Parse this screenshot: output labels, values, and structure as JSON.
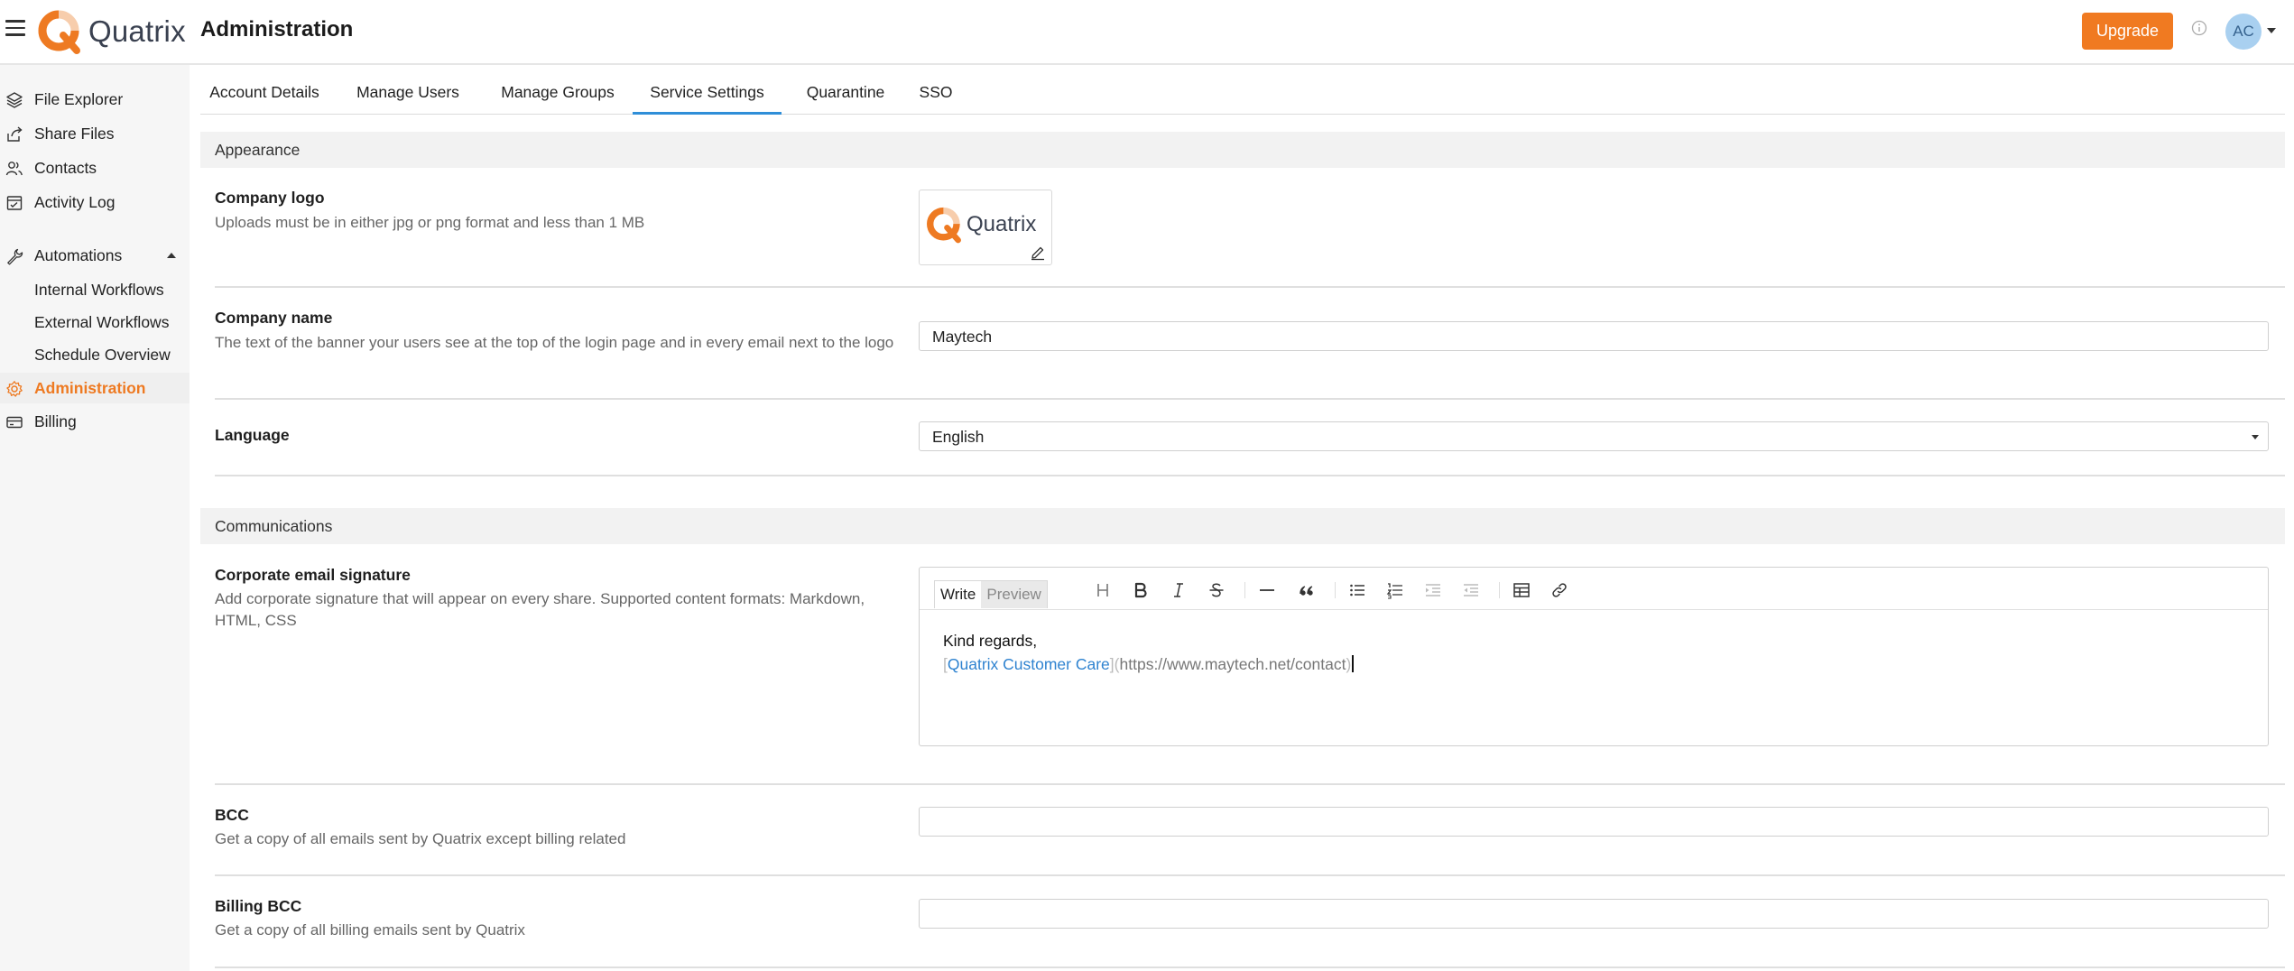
{
  "app": {
    "brand": "Quatrix",
    "page_title": "Administration",
    "upgrade_label": "Upgrade",
    "avatar_initials": "AC",
    "accent_color": "#f07a21"
  },
  "sidebar": {
    "items": [
      {
        "label": "File Explorer",
        "icon": "layers-icon"
      },
      {
        "label": "Share Files",
        "icon": "share-icon"
      },
      {
        "label": "Contacts",
        "icon": "users-icon"
      },
      {
        "label": "Activity Log",
        "icon": "log-icon"
      },
      {
        "label": "Automations",
        "icon": "wrench-icon",
        "expanded": true
      },
      {
        "label": "Internal Workflows"
      },
      {
        "label": "External Workflows"
      },
      {
        "label": "Schedule Overview"
      },
      {
        "label": "Administration",
        "icon": "gear-icon",
        "active": true
      },
      {
        "label": "Billing",
        "icon": "card-icon"
      }
    ]
  },
  "tabs": [
    {
      "label": "Account Details"
    },
    {
      "label": "Manage Users"
    },
    {
      "label": "Manage Groups"
    },
    {
      "label": "Service Settings",
      "active": true
    },
    {
      "label": "Quarantine"
    },
    {
      "label": "SSO"
    }
  ],
  "appearance": {
    "section_title": "Appearance",
    "logo": {
      "label": "Company logo",
      "desc": "Uploads must be in either jpg or png format and less than 1 MB",
      "logo_text": "Quatrix"
    },
    "company_name": {
      "label": "Company name",
      "desc": "The text of the banner your users see at the top of the login page and in every email next to the logo",
      "value": "Maytech"
    },
    "language": {
      "label": "Language",
      "value": "English"
    }
  },
  "communications": {
    "section_title": "Communications",
    "signature": {
      "label": "Corporate email signature",
      "desc": "Add corporate signature that will appear on every share. Supported content formats: Markdown, HTML, CSS",
      "write_label": "Write",
      "preview_label": "Preview",
      "line1": "Kind regards,",
      "link_open": "[",
      "link_text": "Quatrix Customer Care",
      "link_mid": "](",
      "link_url": "https://www.maytech.net/contact",
      "link_close": ")"
    },
    "bcc": {
      "label": "BCC",
      "desc": "Get a copy of all emails sent by Quatrix except billing related",
      "value": ""
    },
    "billing_bcc": {
      "label": "Billing BCC",
      "desc": "Get a copy of all billing emails sent by Quatrix",
      "value": ""
    }
  }
}
